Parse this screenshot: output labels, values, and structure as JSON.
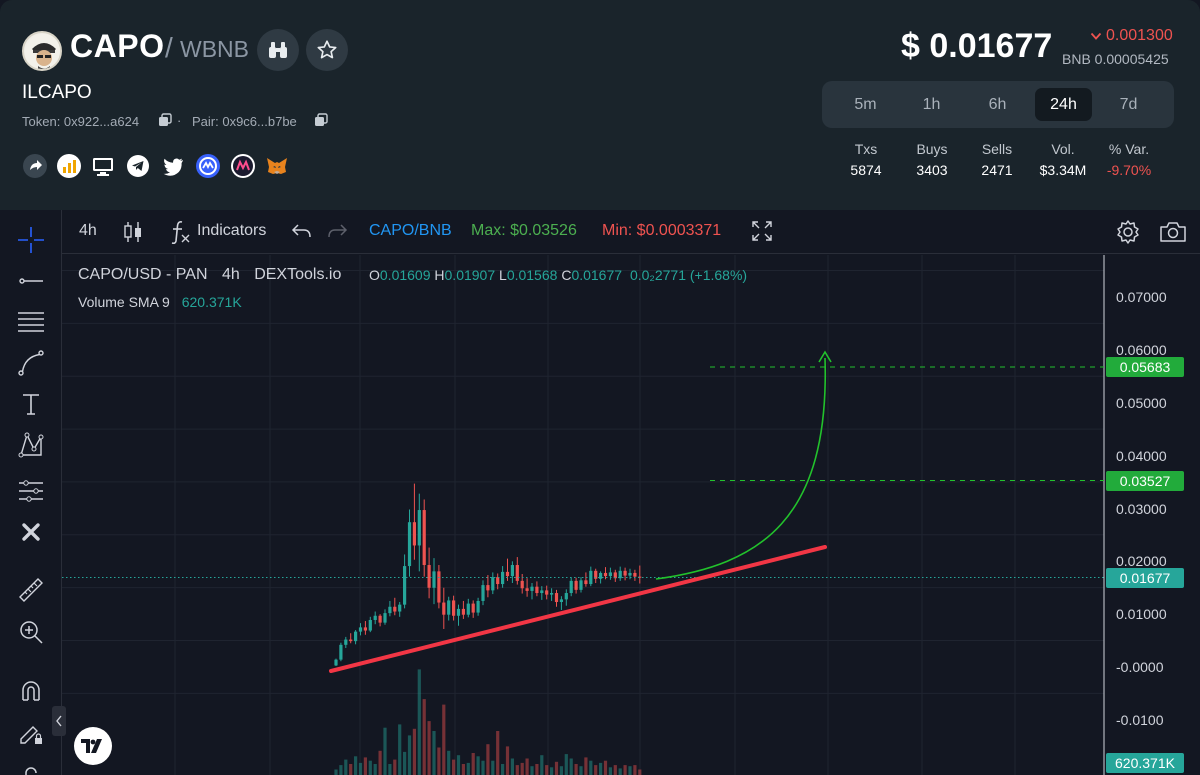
{
  "header": {
    "token_name": "CAPO",
    "slash": "/",
    "pair_quote": "WBNB",
    "project_name": "ILCAPO",
    "token_address": "Token: 0x922...a624",
    "pair_address": "Pair: 0x9c6...b7be",
    "dot": "·",
    "socials": [
      "share-icon",
      "chart-site-icon",
      "website-icon",
      "telegram-icon",
      "twitter-icon",
      "coinmarketcap-icon",
      "multichain-icon",
      "metamask-icon"
    ]
  },
  "price": {
    "usd": "$ 0.01677",
    "change": "0.001300",
    "bnb": "BNB 0.00005425",
    "change_color": "#ef5350"
  },
  "timeframes": [
    {
      "label": "5m",
      "active": false
    },
    {
      "label": "1h",
      "active": false
    },
    {
      "label": "6h",
      "active": false
    },
    {
      "label": "24h",
      "active": true
    },
    {
      "label": "7d",
      "active": false
    }
  ],
  "stats": [
    {
      "label": "Txs",
      "value": "5874"
    },
    {
      "label": "Buys",
      "value": "3403"
    },
    {
      "label": "Sells",
      "value": "2471"
    },
    {
      "label": "Vol.",
      "value": "$3.34M"
    },
    {
      "label": "% Var.",
      "value": "-9.70%"
    }
  ],
  "toolbar": {
    "interval": "4h",
    "indicators": "Indicators",
    "symbol": "CAPO/BNB",
    "max": "Max: $0.03526",
    "min": "Min: $0.0003371"
  },
  "legend": {
    "title": "CAPO/USD - PAN",
    "interval": "4h",
    "source": "DEXTools.io",
    "o_label": "O",
    "o": "0.01609",
    "h_label": "H",
    "h": "0.01907",
    "l_label": "L",
    "l": "0.01568",
    "c_label": "C",
    "c": "0.01677",
    "chg": "0.0₂2771 (+1.68%)",
    "volume_label": "Volume SMA 9",
    "volume_value": "620.371K"
  },
  "y_axis": [
    "0.07000",
    "0.06000",
    "0.05000",
    "0.04000",
    "0.03000",
    "0.02000",
    "0.01000",
    "-0.0000",
    "-0.0100"
  ],
  "price_tags": {
    "target_high": "0.05683",
    "target_mid": "0.03527",
    "current": "0.01677",
    "volume": "620.371K"
  },
  "colors": {
    "up": "#26a69a",
    "down": "#ef5350",
    "trendline": "#f23645",
    "projection": "#22c22c",
    "tag_green": "#22ab3b",
    "tag_teal": "#26a69a"
  },
  "chart_data": {
    "type": "candlestick",
    "series_name": "CAPO/USD",
    "interval": "4h",
    "y_range": [
      -0.013,
      0.0772
    ],
    "ohlc": [
      [
        0.0002,
        0.0015,
        0.0001,
        0.0013
      ],
      [
        0.0013,
        0.0045,
        0.001,
        0.0041
      ],
      [
        0.0041,
        0.0056,
        0.0035,
        0.0051
      ],
      [
        0.0051,
        0.0063,
        0.0044,
        0.0048
      ],
      [
        0.0048,
        0.0069,
        0.0042,
        0.0066
      ],
      [
        0.0066,
        0.0082,
        0.0059,
        0.0074
      ],
      [
        0.0074,
        0.0086,
        0.006,
        0.0068
      ],
      [
        0.0068,
        0.0094,
        0.0065,
        0.0088
      ],
      [
        0.0088,
        0.0104,
        0.008,
        0.0096
      ],
      [
        0.0096,
        0.0099,
        0.0076,
        0.0083
      ],
      [
        0.0083,
        0.0108,
        0.0079,
        0.0101
      ],
      [
        0.0101,
        0.0124,
        0.0095,
        0.0113
      ],
      [
        0.0113,
        0.013,
        0.0097,
        0.0104
      ],
      [
        0.0104,
        0.0122,
        0.0094,
        0.0117
      ],
      [
        0.0117,
        0.0212,
        0.011,
        0.019
      ],
      [
        0.019,
        0.0297,
        0.017,
        0.0273
      ],
      [
        0.0273,
        0.0346,
        0.0202,
        0.0229
      ],
      [
        0.0229,
        0.0327,
        0.018,
        0.0296
      ],
      [
        0.0296,
        0.0316,
        0.017,
        0.0192
      ],
      [
        0.0192,
        0.0225,
        0.0129,
        0.0149
      ],
      [
        0.0149,
        0.0205,
        0.0118,
        0.018
      ],
      [
        0.018,
        0.0192,
        0.011,
        0.0121
      ],
      [
        0.0121,
        0.0149,
        0.0071,
        0.0098
      ],
      [
        0.0098,
        0.0132,
        0.0087,
        0.0125
      ],
      [
        0.0125,
        0.0134,
        0.0087,
        0.0096
      ],
      [
        0.0096,
        0.0117,
        0.0077,
        0.0109
      ],
      [
        0.0109,
        0.0124,
        0.009,
        0.0098
      ],
      [
        0.0098,
        0.0128,
        0.0093,
        0.0119
      ],
      [
        0.0119,
        0.0125,
        0.0092,
        0.0102
      ],
      [
        0.0102,
        0.013,
        0.0096,
        0.0124
      ],
      [
        0.0124,
        0.0163,
        0.0116,
        0.0154
      ],
      [
        0.0154,
        0.0173,
        0.0131,
        0.0144
      ],
      [
        0.0144,
        0.0178,
        0.0137,
        0.0169
      ],
      [
        0.0169,
        0.0176,
        0.0146,
        0.0156
      ],
      [
        0.0156,
        0.019,
        0.0149,
        0.0179
      ],
      [
        0.0179,
        0.0204,
        0.0162,
        0.0171
      ],
      [
        0.0171,
        0.0199,
        0.0158,
        0.0192
      ],
      [
        0.0192,
        0.0207,
        0.0155,
        0.0162
      ],
      [
        0.0162,
        0.0175,
        0.0138,
        0.0148
      ],
      [
        0.0148,
        0.0167,
        0.0132,
        0.0143
      ],
      [
        0.0143,
        0.0158,
        0.0127,
        0.0151
      ],
      [
        0.0151,
        0.0161,
        0.0133,
        0.0139
      ],
      [
        0.0139,
        0.0152,
        0.0126,
        0.0144
      ],
      [
        0.0144,
        0.0153,
        0.0127,
        0.0136
      ],
      [
        0.0136,
        0.0148,
        0.0124,
        0.0139
      ],
      [
        0.0139,
        0.0145,
        0.0113,
        0.0122
      ],
      [
        0.0122,
        0.0133,
        0.0107,
        0.0127
      ],
      [
        0.0127,
        0.0146,
        0.0115,
        0.0139
      ],
      [
        0.0139,
        0.0169,
        0.0133,
        0.0162
      ],
      [
        0.0162,
        0.0168,
        0.0138,
        0.0145
      ],
      [
        0.0145,
        0.0169,
        0.014,
        0.0163
      ],
      [
        0.0163,
        0.0178,
        0.0151,
        0.0156
      ],
      [
        0.0156,
        0.0189,
        0.0152,
        0.0181
      ],
      [
        0.0181,
        0.0185,
        0.0158,
        0.0166
      ],
      [
        0.0166,
        0.018,
        0.0157,
        0.0177
      ],
      [
        0.0177,
        0.0188,
        0.0165,
        0.0171
      ],
      [
        0.0171,
        0.0187,
        0.0164,
        0.0178
      ],
      [
        0.0178,
        0.0183,
        0.016,
        0.0167
      ],
      [
        0.0167,
        0.0189,
        0.0162,
        0.0181
      ],
      [
        0.0181,
        0.0187,
        0.0163,
        0.0172
      ],
      [
        0.0172,
        0.0185,
        0.0165,
        0.0177
      ],
      [
        0.0177,
        0.0183,
        0.0162,
        0.017
      ],
      [
        0.017,
        0.0191,
        0.0157,
        0.0168
      ]
    ],
    "volume": [
      0.5,
      0.9,
      1.4,
      1.0,
      1.7,
      1.1,
      1.6,
      1.3,
      1.0,
      2.2,
      4.3,
      1.0,
      1.4,
      4.6,
      2.1,
      3.6,
      4.2,
      9.6,
      6.9,
      4.9,
      4.0,
      2.5,
      6.4,
      2.2,
      1.4,
      1.8,
      1.0,
      1.1,
      2.0,
      1.7,
      1.3,
      2.8,
      1.3,
      4.0,
      1.0,
      2.6,
      1.5,
      0.9,
      1.1,
      1.5,
      0.8,
      1.0,
      1.8,
      0.9,
      0.7,
      1.2,
      0.8,
      1.9,
      1.5,
      1.0,
      0.8,
      1.6,
      1.3,
      0.9,
      1.1,
      1.3,
      0.7,
      0.9,
      0.6,
      0.9,
      0.8,
      0.9,
      0.5
    ]
  }
}
